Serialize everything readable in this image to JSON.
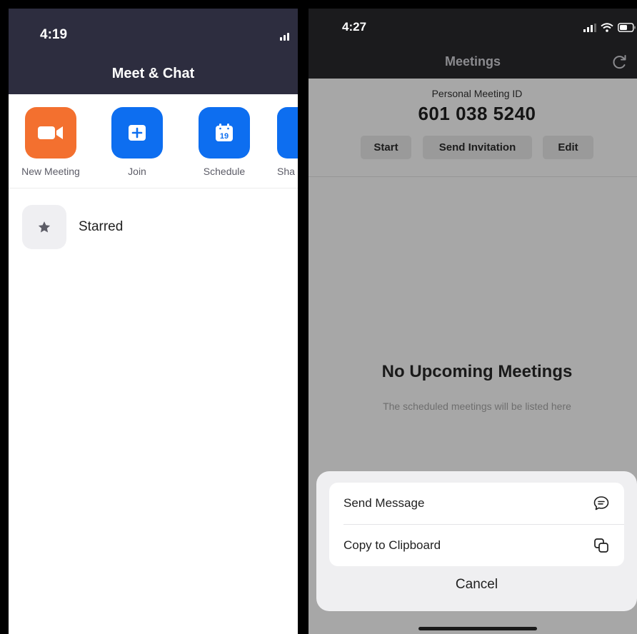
{
  "left": {
    "status_time": "4:19",
    "title": "Meet & Chat",
    "actions": [
      {
        "label": "New Meeting",
        "icon": "video-camera-icon",
        "color": "#f3702f"
      },
      {
        "label": "Join",
        "icon": "plus-icon",
        "color": "#0d6ef0"
      },
      {
        "label": "Schedule",
        "icon": "calendar-icon",
        "day": "19",
        "color": "#0d6ef0"
      },
      {
        "label": "Sha",
        "icon": "share-icon",
        "color": "#0d6ef0"
      }
    ],
    "starred_label": "Starred"
  },
  "right": {
    "status_time": "4:27",
    "title": "Meetings",
    "personal_meeting_id_label": "Personal Meeting ID",
    "personal_meeting_id": "601 038 5240",
    "buttons": {
      "start": "Start",
      "send_invitation": "Send Invitation",
      "edit": "Edit"
    },
    "empty_title": "No Upcoming Meetings",
    "empty_subtitle": "The scheduled meetings will be listed here",
    "sheet": {
      "send_message": "Send Message",
      "copy_clipboard": "Copy to Clipboard",
      "cancel": "Cancel"
    }
  },
  "colors": {
    "accent_blue": "#0d6ef0",
    "accent_orange": "#f3702f",
    "header_dark": "#2d2d3f"
  }
}
